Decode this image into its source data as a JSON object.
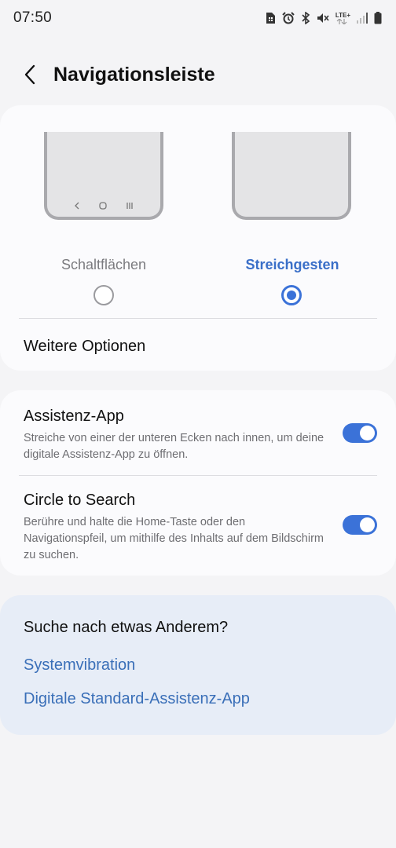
{
  "status": {
    "time": "07:50",
    "network_label": "LTE+"
  },
  "header": {
    "title": "Navigationsleiste"
  },
  "nav_type": {
    "options": [
      {
        "label": "Schaltflächen",
        "selected": false
      },
      {
        "label": "Streichgesten",
        "selected": true
      }
    ],
    "more_options": "Weitere Optionen"
  },
  "toggles": [
    {
      "title": "Assistenz-App",
      "description": "Streiche von einer der unteren Ecken nach innen, um deine digitale Assistenz-App zu öffnen.",
      "enabled": true
    },
    {
      "title": "Circle to Search",
      "description": "Berühre und halte die Home-Taste oder den Navigationspfeil, um mithilfe des Inhalts auf dem Bildschirm zu suchen.",
      "enabled": true
    }
  ],
  "suggestions": {
    "title": "Suche nach etwas Anderem?",
    "links": [
      "Systemvibration",
      "Digitale Standard-Assistenz-App"
    ]
  },
  "colors": {
    "accent": "#3b72d8",
    "link": "#3a6fb8",
    "background": "#f4f4f6"
  }
}
